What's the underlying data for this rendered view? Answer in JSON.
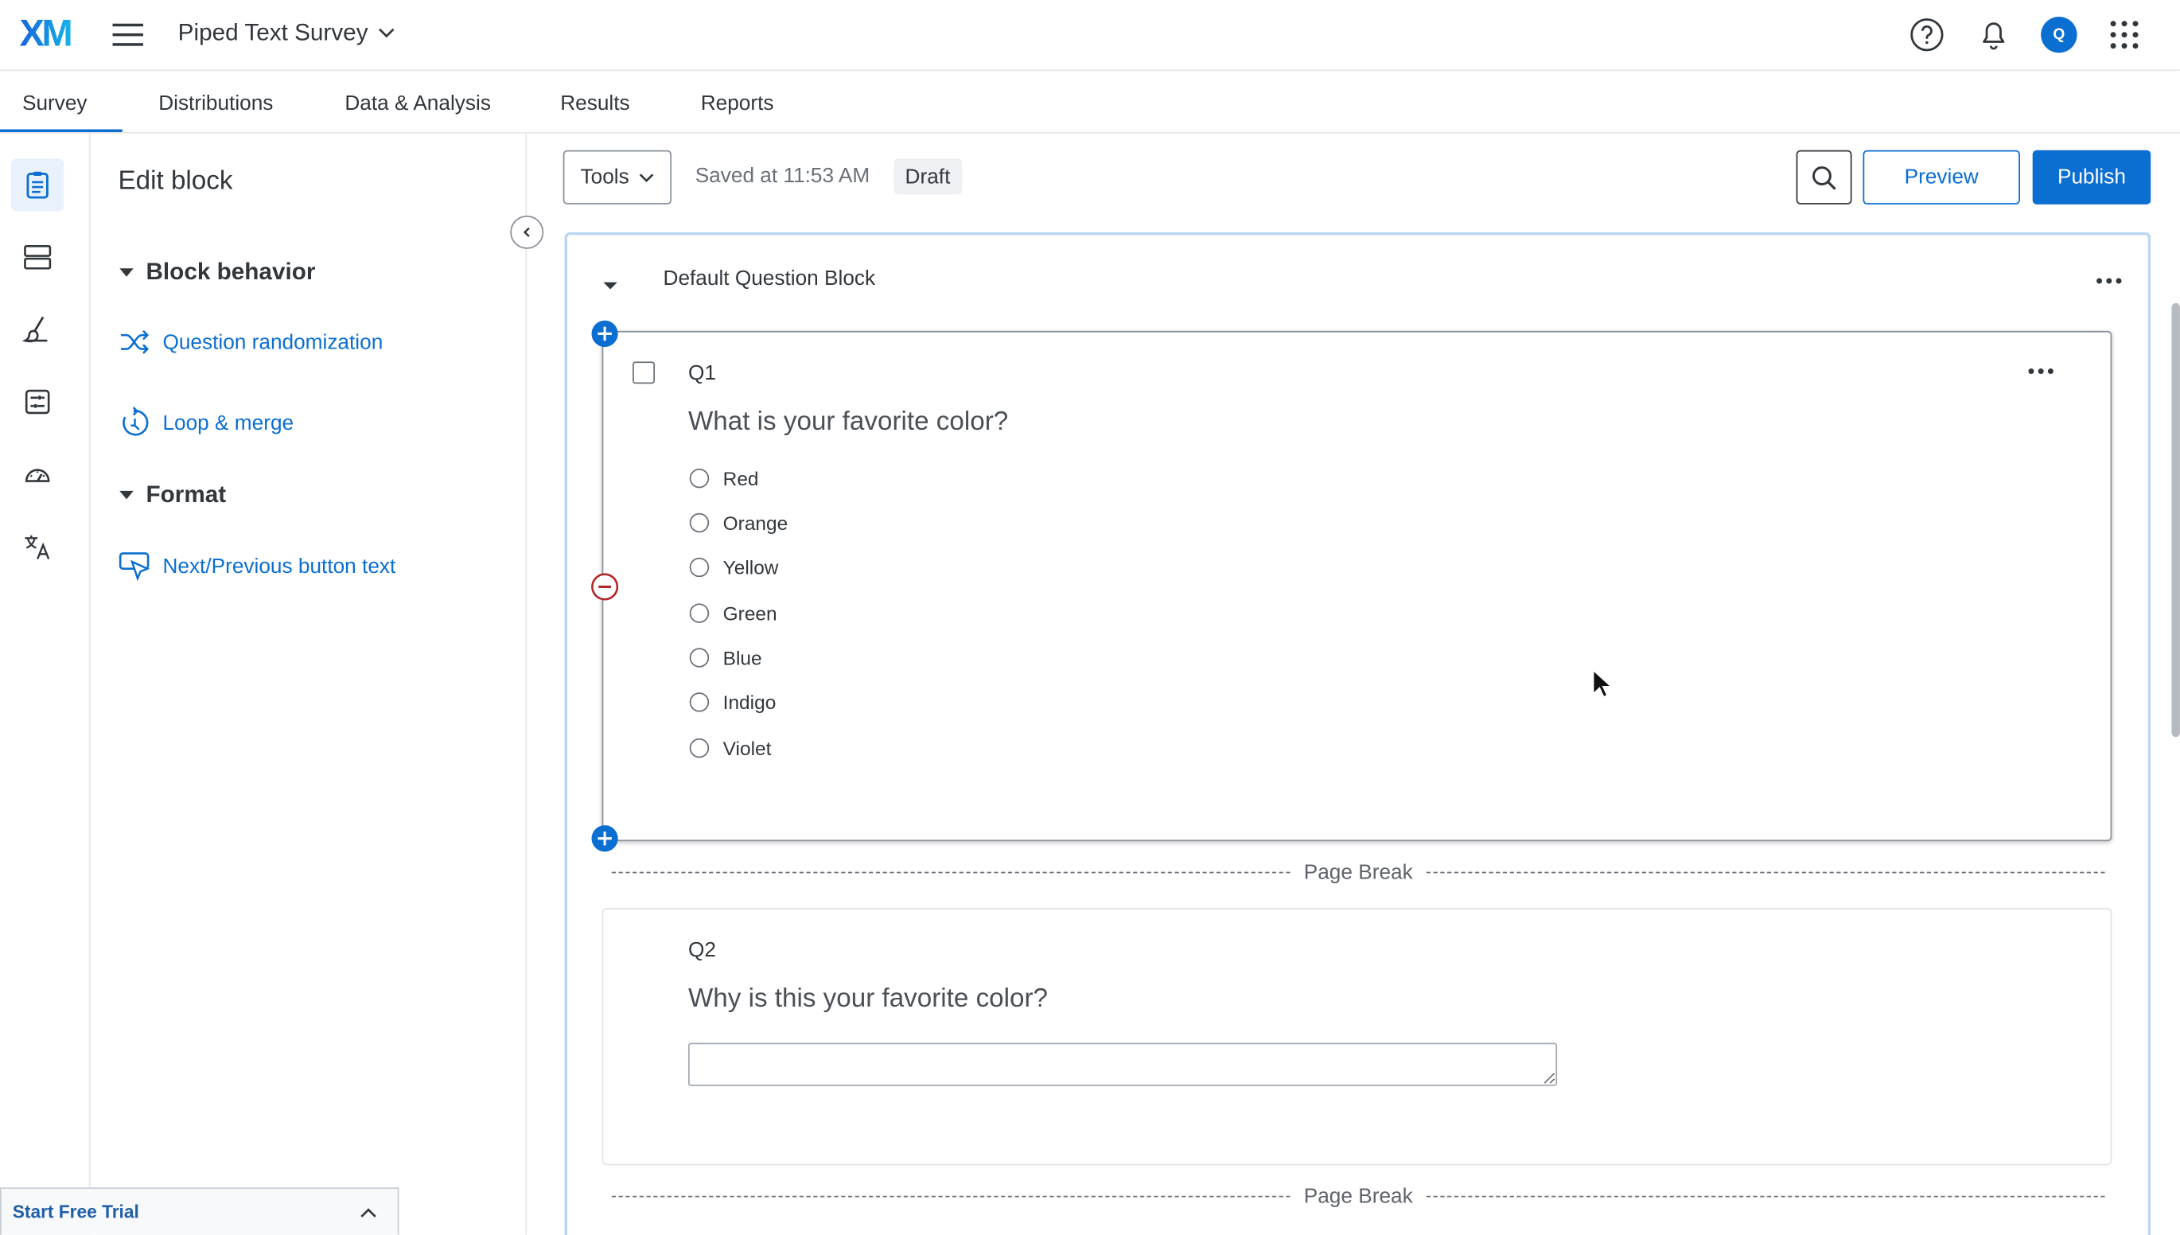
{
  "app": {
    "logo": "XM",
    "project_name": "Piped Text Survey",
    "avatar_initial": "Q"
  },
  "tabs": [
    {
      "label": "Survey",
      "active": true
    },
    {
      "label": "Distributions"
    },
    {
      "label": "Data & Analysis"
    },
    {
      "label": "Results"
    },
    {
      "label": "Reports"
    }
  ],
  "rail_icons": [
    "survey-icon",
    "blocks-icon",
    "look-and-feel-icon",
    "survey-flow-icon",
    "survey-options-icon",
    "translate-icon"
  ],
  "panel": {
    "title": "Edit block",
    "block_behavior": "Block behavior",
    "question_randomization": "Question randomization",
    "loop_merge": "Loop & merge",
    "format": "Format",
    "next_prev_text": "Next/Previous button text",
    "trial": "Start Free Trial"
  },
  "toolbar": {
    "tools_label": "Tools",
    "saved_text": "Saved at 11:53 AM",
    "status": "Draft",
    "preview_label": "Preview",
    "publish_label": "Publish"
  },
  "block": {
    "title": "Default Question Block",
    "page_break": "Page Break"
  },
  "q1": {
    "id": "Q1",
    "text": "What is your favorite color?",
    "choices": [
      "Red",
      "Orange",
      "Yellow",
      "Green",
      "Blue",
      "Indigo",
      "Violet"
    ]
  },
  "q2": {
    "id": "Q2",
    "text": "Why is this your favorite color?",
    "value": ""
  },
  "colors": {
    "accent": "#0b6ed1",
    "remove": "#b3272a"
  }
}
